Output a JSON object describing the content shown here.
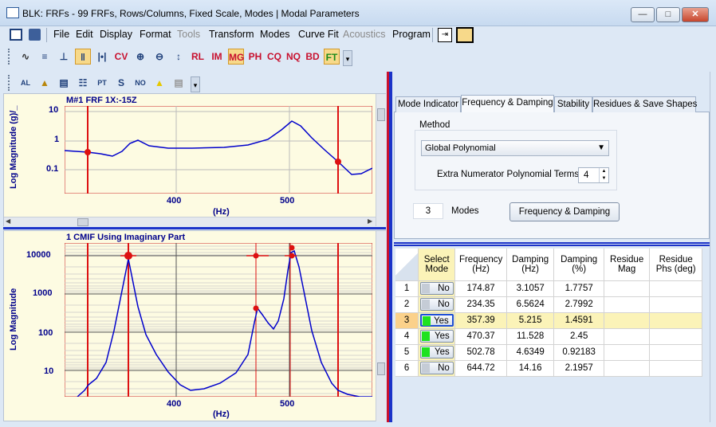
{
  "window": {
    "title": "BLK: FRFs - 99 FRFs, Rows/Columns, Fixed Scale, Modes | Modal Parameters"
  },
  "menu": {
    "items": [
      "File",
      "Edit",
      "Display",
      "Format",
      "Tools",
      "Transform",
      "Modes",
      "Curve Fit",
      "Acoustics",
      "Program"
    ],
    "disabled": [
      "Tools",
      "Acoustics"
    ]
  },
  "toolbar1": {
    "icons": [
      "RL",
      "IM",
      "MG",
      "PH",
      "CQ",
      "NQ",
      "BD"
    ]
  },
  "plot1": {
    "title": "M#1 FRF 1X:-15Z",
    "ylabel": "Log Magnitude (g)/_",
    "yticks": [
      "10",
      "1",
      "0.1"
    ],
    "xticks": [
      "400",
      "500"
    ],
    "xunit": "(Hz)"
  },
  "plot2": {
    "title": "1 CMIF Using Imaginary Part",
    "ylabel": "Log Magnitude",
    "yticks": [
      "10000",
      "1000",
      "100",
      "10"
    ],
    "xticks": [
      "400",
      "500"
    ],
    "xunit": "(Hz)"
  },
  "tabs": [
    "Mode Indicator",
    "Frequency & Damping",
    "Stability",
    "Residues & Save Shapes"
  ],
  "method": {
    "label": "Method",
    "selected": "Global Polynomial",
    "extra_label": "Extra Numerator Polynomial Terms",
    "extra_value": "4",
    "modes_value": "3",
    "modes_label": "Modes",
    "button": "Frequency & Damping"
  },
  "table": {
    "headers": [
      "Select\nMode",
      "Frequency\n(Hz)",
      "Damping\n(Hz)",
      "Damping\n(%)",
      "Residue\nMag",
      "Residue\nPhs (deg)"
    ],
    "rows": [
      {
        "n": "1",
        "sel": "No",
        "freq": "174.87",
        "dhz": "3.1057",
        "dpct": "1.7757"
      },
      {
        "n": "2",
        "sel": "No",
        "freq": "234.35",
        "dhz": "6.5624",
        "dpct": "2.7992"
      },
      {
        "n": "3",
        "sel": "Yes",
        "freq": "357.39",
        "dhz": "5.215",
        "dpct": "1.4591"
      },
      {
        "n": "4",
        "sel": "Yes",
        "freq": "470.37",
        "dhz": "11.528",
        "dpct": "2.45"
      },
      {
        "n": "5",
        "sel": "Yes",
        "freq": "502.78",
        "dhz": "4.6349",
        "dpct": "0.92183"
      },
      {
        "n": "6",
        "sel": "No",
        "freq": "644.72",
        "dhz": "14.16",
        "dpct": "2.1957"
      }
    ]
  },
  "colors": {
    "curve": "#0000cc",
    "cursor": "#dd1111",
    "header": "#fbf3b8",
    "accent": "#1e4fd6"
  }
}
